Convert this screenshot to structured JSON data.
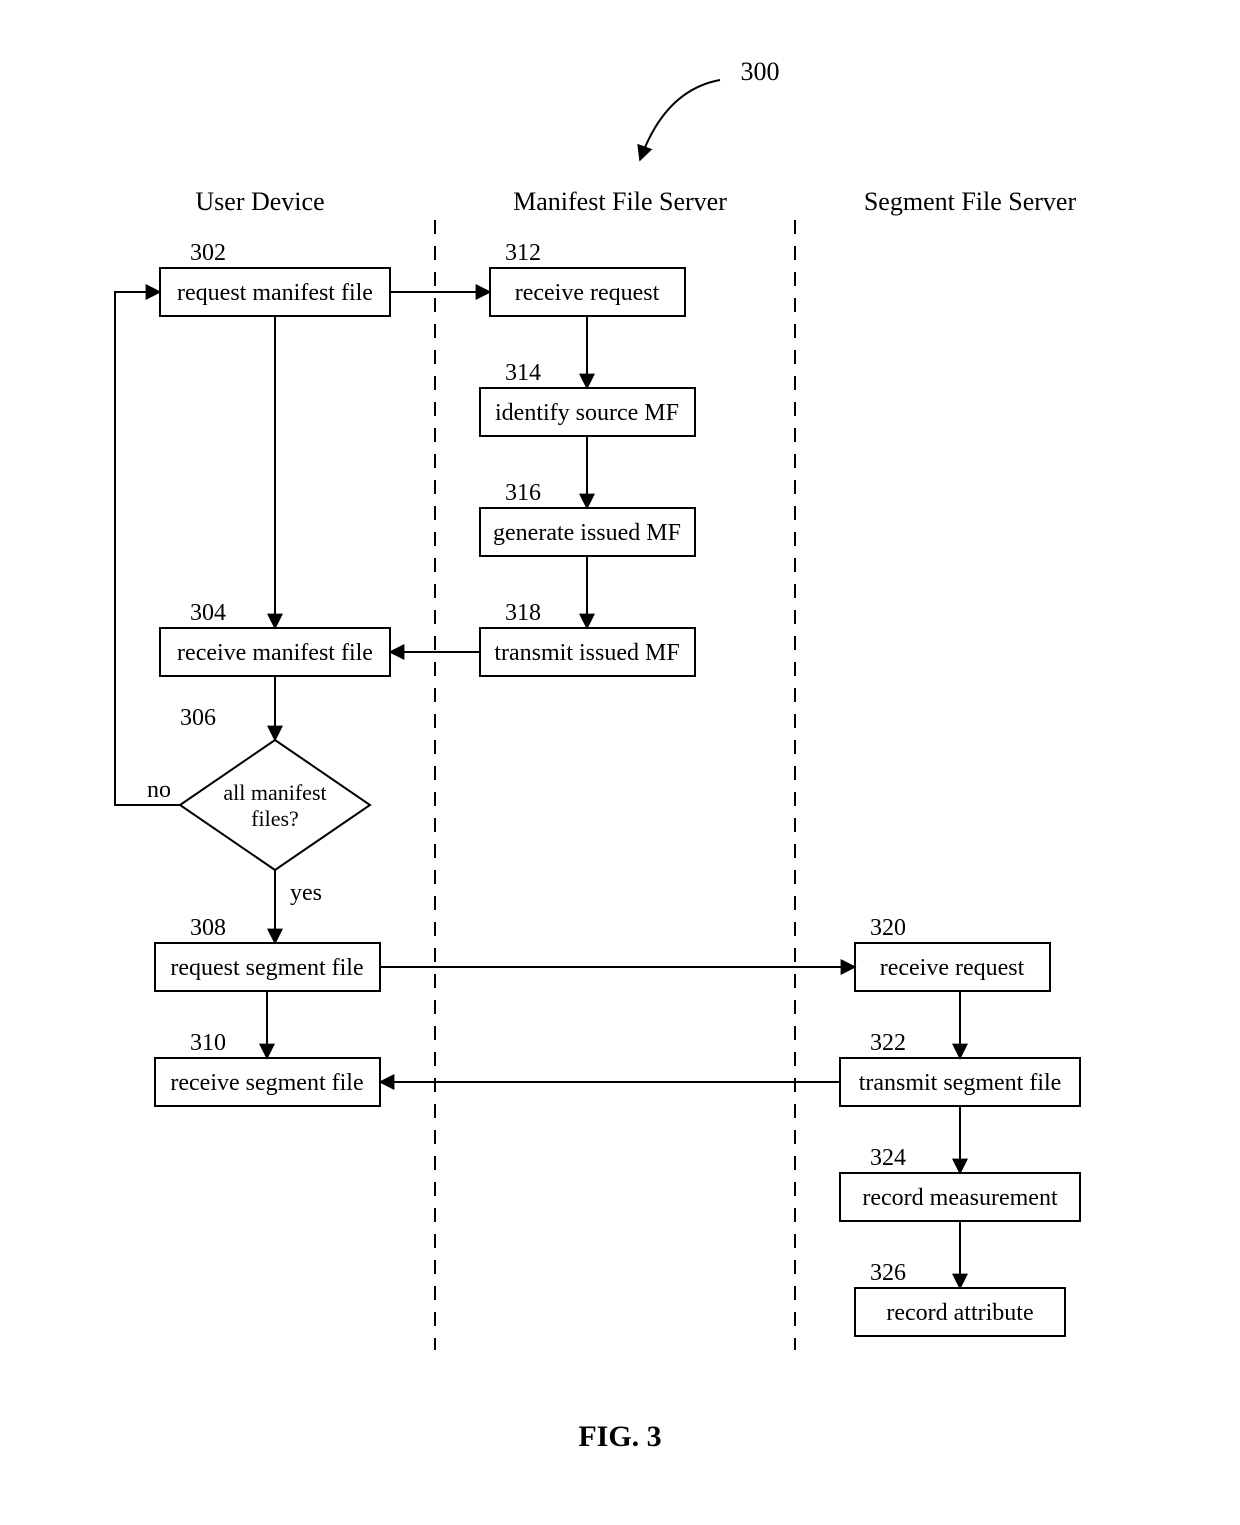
{
  "figureNumber": "300",
  "lanes": {
    "user": "User Device",
    "mfs": "Manifest File Server",
    "sfs": "Segment File Server"
  },
  "nodes": {
    "n302": {
      "num": "302",
      "label": "request manifest file"
    },
    "n304": {
      "num": "304",
      "label": "receive manifest file"
    },
    "n306": {
      "num": "306",
      "label": "all manifest files?"
    },
    "n308": {
      "num": "308",
      "label": "request segment file"
    },
    "n310": {
      "num": "310",
      "label": "receive segment file"
    },
    "n312": {
      "num": "312",
      "label": "receive request"
    },
    "n314": {
      "num": "314",
      "label": "identify source MF"
    },
    "n316": {
      "num": "316",
      "label": "generate issued MF"
    },
    "n318": {
      "num": "318",
      "label": "transmit issued MF"
    },
    "n320": {
      "num": "320",
      "label": "receive request"
    },
    "n322": {
      "num": "322",
      "label": "transmit segment file"
    },
    "n324": {
      "num": "324",
      "label": "record measurement"
    },
    "n326": {
      "num": "326",
      "label": "record attribute"
    }
  },
  "edgeLabels": {
    "no": "no",
    "yes": "yes"
  },
  "caption": "FIG. 3"
}
